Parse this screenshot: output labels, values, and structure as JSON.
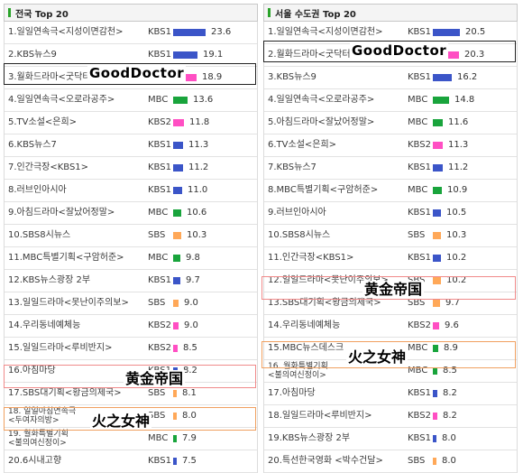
{
  "colors": {
    "KBS1": "#3b55c8",
    "KBS2": "#ff4fc3",
    "MBC": "#19a43c",
    "SBS": "#ffa858"
  },
  "left_panel": {
    "title": "전국 Top 20",
    "rows": [
      {
        "title": "1.일일연속극<지성이면감천>",
        "network": "KBS1",
        "rating": 23.6
      },
      {
        "title": "2.KBS뉴스9",
        "network": "KBS1",
        "rating": 19.1
      },
      {
        "title": "3.월화드라마<굿닥터>",
        "network": "KBS2",
        "rating": 18.9
      },
      {
        "title": "4.일일연속극<오로라공주>",
        "network": "MBC",
        "rating": 13.6
      },
      {
        "title": "5.TV소설<은희>",
        "network": "KBS2",
        "rating": 11.8
      },
      {
        "title": "6.KBS뉴스7",
        "network": "KBS1",
        "rating": 11.3
      },
      {
        "title": "7.인간극장<KBS1>",
        "network": "KBS1",
        "rating": 11.2
      },
      {
        "title": "8.러브인아시아",
        "network": "KBS1",
        "rating": 11.0
      },
      {
        "title": "9.아침드라마<잘났어정말>",
        "network": "MBC",
        "rating": 10.6
      },
      {
        "title": "10.SBS8시뉴스",
        "network": "SBS",
        "rating": 10.3
      },
      {
        "title": "11.MBC특별기획<구암허준>",
        "network": "MBC",
        "rating": 9.8
      },
      {
        "title": "12.KBS뉴스광장 2부",
        "network": "KBS1",
        "rating": 9.7
      },
      {
        "title": "13.일일드라마<못난이주의보>",
        "network": "SBS",
        "rating": 9.0
      },
      {
        "title": "14.우리동네예체능",
        "network": "KBS2",
        "rating": 9.0
      },
      {
        "title": "15.일일드라마<루비반지>",
        "network": "KBS2",
        "rating": 8.5
      },
      {
        "title": "16.아침마당",
        "network": "KBS1",
        "rating": 8.2
      },
      {
        "title": "17.SBS대기획<황금의제국>",
        "network": "SBS",
        "rating": 8.1
      },
      {
        "title": "18. 일일아침연속극",
        "title2": "<두여자의방>",
        "network": "SBS",
        "rating": 8.0
      },
      {
        "title": "19. 월화특별기획",
        "title2": "<불의여신정이>",
        "network": "MBC",
        "rating": 7.9
      },
      {
        "title": "20.6시내고향",
        "network": "KBS1",
        "rating": 7.5
      }
    ]
  },
  "right_panel": {
    "title": "서울 수도권 Top 20",
    "rows": [
      {
        "title": "1.일일연속극<지성이면감천>",
        "network": "KBS1",
        "rating": 20.5
      },
      {
        "title": "2.월화드라마<굿닥터>",
        "network": "KBS2",
        "rating": 20.3
      },
      {
        "title": "3.KBS뉴스9",
        "network": "KBS1",
        "rating": 16.2
      },
      {
        "title": "4.일일연속극<오로라공주>",
        "network": "MBC",
        "rating": 14.8
      },
      {
        "title": "5.아침드라마<잘났어정말>",
        "network": "MBC",
        "rating": 11.6
      },
      {
        "title": "6.TV소설<은희>",
        "network": "KBS2",
        "rating": 11.3
      },
      {
        "title": "7.KBS뉴스7",
        "network": "KBS1",
        "rating": 11.2
      },
      {
        "title": "8.MBC특별기획<구암허준>",
        "network": "MBC",
        "rating": 10.9
      },
      {
        "title": "9.러브인아시아",
        "network": "KBS1",
        "rating": 10.5
      },
      {
        "title": "10.SBS8시뉴스",
        "network": "SBS",
        "rating": 10.3
      },
      {
        "title": "11.인간극장<KBS1>",
        "network": "KBS1",
        "rating": 10.2
      },
      {
        "title": "12.일일드라마<못난이주의보>",
        "network": "SBS",
        "rating": 10.2
      },
      {
        "title": "13.SBS대기획<황금의제국>",
        "network": "SBS",
        "rating": 9.7
      },
      {
        "title": "14.우리동네예체능",
        "network": "KBS2",
        "rating": 9.6
      },
      {
        "title": "15.MBC뉴스데스크",
        "network": "MBC",
        "rating": 8.9
      },
      {
        "title": "16. 월화특별기획",
        "title2": "<불의여신정이>",
        "network": "MBC",
        "rating": 8.5
      },
      {
        "title": "17.아침마당",
        "network": "KBS1",
        "rating": 8.2
      },
      {
        "title": "18.일일드라마<루비반지>",
        "network": "KBS2",
        "rating": 8.2
      },
      {
        "title": "19.KBS뉴스광장 2부",
        "network": "KBS1",
        "rating": 8.0
      },
      {
        "title": "20.특선한국영화 <박수건달>",
        "network": "SBS",
        "rating": 8.0
      }
    ]
  },
  "annotations": {
    "good_doctor": "GoodDoctor",
    "empire_of_gold": "黄金帝国",
    "goddess_of_fire": "火之女神"
  }
}
